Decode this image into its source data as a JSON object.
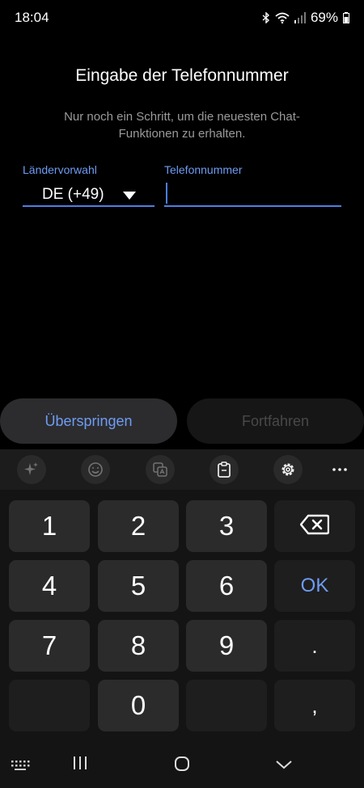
{
  "status": {
    "time": "18:04",
    "battery": "69%"
  },
  "screen": {
    "title": "Eingabe der Telefonnummer",
    "subtitle": "Nur noch ein Schritt, um die neuesten Chat-Funktionen zu erhalten."
  },
  "form": {
    "country_label": "Ländervorwahl",
    "country_value": "DE (+49)",
    "phone_label": "Telefonnummer",
    "phone_value": ""
  },
  "actions": {
    "skip": "Überspringen",
    "continue": "Fortfahren"
  },
  "keyboard": {
    "toolbar_icons": [
      "ai-sparkle-icon",
      "emoji-icon",
      "translate-icon",
      "clipboard-icon",
      "settings-icon",
      "more-icon"
    ],
    "keys": {
      "k1": "1",
      "k2": "2",
      "k3": "3",
      "k4": "4",
      "k5": "5",
      "k6": "6",
      "k7": "7",
      "k8": "8",
      "k9": "9",
      "k0": "0",
      "ok": "OK",
      "period": ".",
      "comma": ","
    }
  },
  "nav": {
    "icons": [
      "keyboard-switch-icon",
      "recents-icon",
      "home-icon",
      "back-icon"
    ]
  },
  "colors": {
    "accent": "#6f9cf3",
    "underline": "#4d7fe0",
    "background": "#000000"
  }
}
